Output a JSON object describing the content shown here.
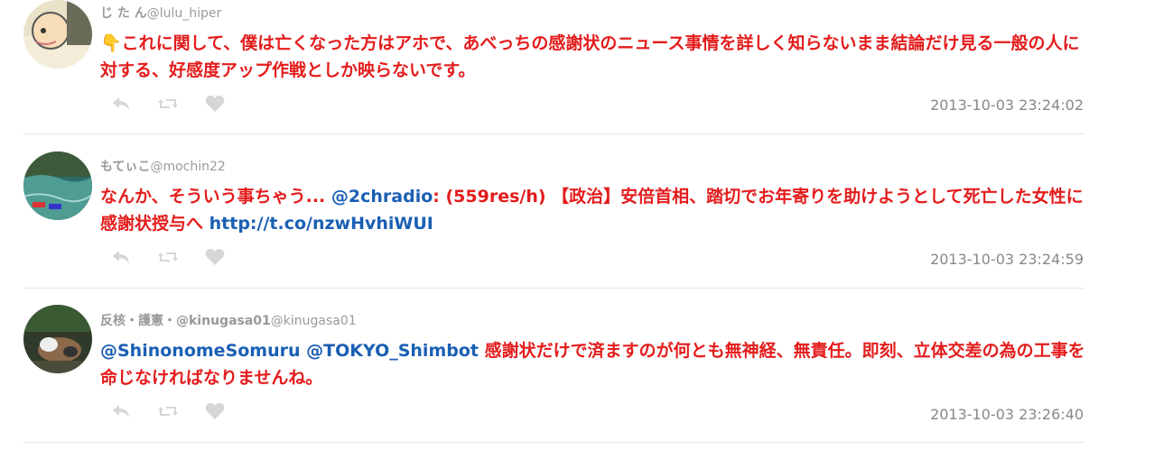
{
  "tweets": [
    {
      "name": "じ た ん",
      "handle": "@lulu_hiper",
      "emoji": "👇",
      "text": "これに関して、僕は亡くなった方はアホで、あべっちの感謝状のニュース事情を詳しく知らないまま結論だけ見る一般の人に対する、好感度アップ作戦としか映らないです。",
      "timestamp": "2013-10-03 23:24:02"
    },
    {
      "name": "もてぃこ",
      "handle": "@mochin22",
      "text_before": "なんか、そういう事ちゃう... ",
      "mention": "@2chradio",
      "text_middle": ": (559res/h) 【政治】安倍首相、踏切でお年寄りを助けようとして死亡した女性に感謝状授与へ ",
      "url": "http://t.co/nzwHvhiWUI",
      "timestamp": "2013-10-03 23:24:59"
    },
    {
      "name": "反核・護憲・@kinugasa01",
      "handle": "@kinugasa01",
      "mention1": "@ShinonomeSomuru",
      "mention2": "@TOKYO_Shimbot",
      "text": " 感謝状だけで済ますのが何とも無神経、無責任。即刻、立体交差の為の工事を命じなければなりませんね。",
      "timestamp": "2013-10-03 23:26:40"
    }
  ],
  "icons": [
    "reply-icon",
    "retweet-icon",
    "favorite-icon"
  ],
  "colors": {
    "tweet_text": "#e41c1c",
    "link": "#1a5fb4",
    "meta": "#888888"
  }
}
